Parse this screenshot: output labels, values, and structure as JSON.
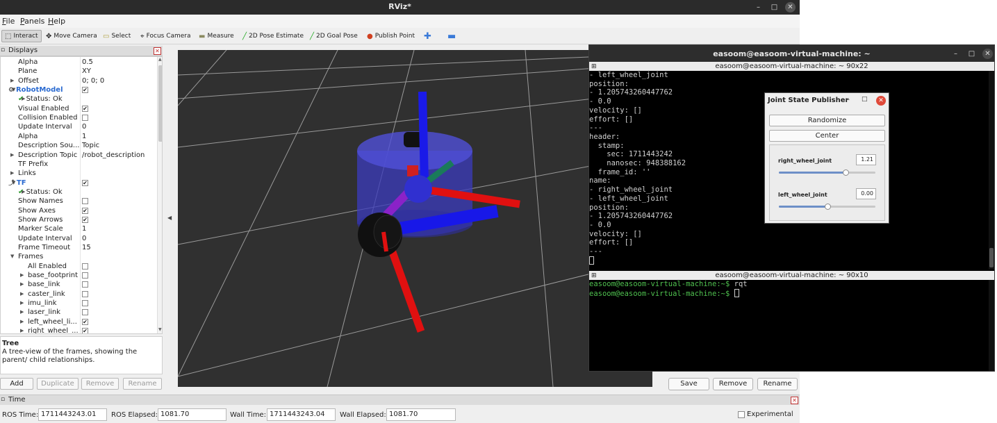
{
  "rviz": {
    "title": "RViz*",
    "menu": [
      "File",
      "Panels",
      "Help"
    ],
    "tools": [
      {
        "label": "Interact",
        "icon": "cursor-icon",
        "glyph": "⬚"
      },
      {
        "label": "Move Camera",
        "icon": "move-camera-icon",
        "glyph": "✥"
      },
      {
        "label": "Select",
        "icon": "select-icon",
        "glyph": "▭"
      },
      {
        "label": "Focus Camera",
        "icon": "focus-camera-icon",
        "glyph": "⌖"
      },
      {
        "label": "Measure",
        "icon": "measure-icon",
        "glyph": "▬"
      },
      {
        "label": "2D Pose Estimate",
        "icon": "pose-estimate-icon",
        "glyph": "╱"
      },
      {
        "label": "2D Goal Pose",
        "icon": "goal-pose-icon",
        "glyph": "╱"
      },
      {
        "label": "Publish Point",
        "icon": "publish-point-icon",
        "glyph": "●"
      }
    ],
    "displays_title": "Displays",
    "tree": [
      {
        "label": "Alpha",
        "value": "0.5",
        "indent": 25
      },
      {
        "label": "Plane",
        "value": "XY",
        "indent": 25
      },
      {
        "label": "Offset",
        "value": "0; 0; 0",
        "indent": 25,
        "arrow": true
      },
      {
        "label": "RobotModel",
        "checked": true,
        "indent": 27,
        "arrow": "down",
        "kind": "display"
      },
      {
        "label": "Status: Ok",
        "indent": 41,
        "arrow": true,
        "status": true
      },
      {
        "label": "Visual Enabled",
        "checked": true,
        "indent": 25
      },
      {
        "label": "Collision Enabled",
        "checked": false,
        "indent": 25
      },
      {
        "label": "Update Interval",
        "value": "0",
        "indent": 25
      },
      {
        "label": "Alpha",
        "value": "1",
        "indent": 25
      },
      {
        "label": "Description Sou...",
        "value": "Topic",
        "indent": 25
      },
      {
        "label": "Description Topic",
        "value": "/robot_description",
        "indent": 25,
        "arrow": true
      },
      {
        "label": "TF Prefix",
        "value": "",
        "indent": 25
      },
      {
        "label": "Links",
        "value": "",
        "indent": 25,
        "arrow": true
      },
      {
        "label": "TF",
        "checked": true,
        "indent": 27,
        "arrow": "down",
        "kind": "display"
      },
      {
        "label": "Status: Ok",
        "indent": 41,
        "arrow": true,
        "status": true
      },
      {
        "label": "Show Names",
        "checked": false,
        "indent": 25
      },
      {
        "label": "Show Axes",
        "checked": true,
        "indent": 25
      },
      {
        "label": "Show Arrows",
        "checked": true,
        "indent": 25
      },
      {
        "label": "Marker Scale",
        "value": "1",
        "indent": 25
      },
      {
        "label": "Update Interval",
        "value": "0",
        "indent": 25
      },
      {
        "label": "Frame Timeout",
        "value": "15",
        "indent": 25
      },
      {
        "label": "Frames",
        "value": "",
        "indent": 25,
        "arrow": "down"
      },
      {
        "label": "All Enabled",
        "checked": false,
        "indent": 39
      },
      {
        "label": "base_footprint",
        "checked": false,
        "indent": 39,
        "arrow": true
      },
      {
        "label": "base_link",
        "checked": false,
        "indent": 39,
        "arrow": true
      },
      {
        "label": "caster_link",
        "checked": false,
        "indent": 39,
        "arrow": true
      },
      {
        "label": "imu_link",
        "checked": false,
        "indent": 39,
        "arrow": true
      },
      {
        "label": "laser_link",
        "checked": false,
        "indent": 39,
        "arrow": true
      },
      {
        "label": "left_wheel_li...",
        "checked": true,
        "indent": 39,
        "arrow": true
      },
      {
        "label": "right_wheel_...",
        "checked": true,
        "indent": 39,
        "arrow": true
      }
    ],
    "description": {
      "title": "Tree",
      "text": "A tree-view of the frames, showing the parent/ child relationships."
    },
    "panel_buttons": [
      {
        "label": "Add",
        "enabled": true
      },
      {
        "label": "Duplicate",
        "enabled": false
      },
      {
        "label": "Remove",
        "enabled": false
      },
      {
        "label": "Rename",
        "enabled": false
      }
    ],
    "view_buttons": [
      "Save",
      "Remove",
      "Rename"
    ],
    "time": {
      "title": "Time",
      "ros_time_label": "ROS Time:",
      "ros_time": "1711443243.01",
      "ros_elapsed_label": "ROS Elapsed:",
      "ros_elapsed": "1081.70",
      "wall_time_label": "Wall Time:",
      "wall_time": "1711443243.04",
      "wall_elapsed_label": "Wall Elapsed:",
      "wall_elapsed": "1081.70",
      "experimental_label": "Experimental"
    }
  },
  "terminal": {
    "title": "easoom@easoom-virtual-machine: ~",
    "pane1_title": "easoom@easoom-virtual-machine: ~ 90x22",
    "pane1_lines": [
      "- left_wheel_joint",
      "position:",
      "- 1.205743260447762",
      "- 0.0",
      "velocity: []",
      "effort: []",
      "---",
      "header:",
      "  stamp:",
      "    sec: 1711443242",
      "    nanosec: 948388162",
      "  frame_id: ''",
      "name:",
      "- right_wheel_joint",
      "- left_wheel_joint",
      "position:",
      "- 1.205743260447762",
      "- 0.0",
      "velocity: []",
      "effort: []",
      "---"
    ],
    "pane2_title": "easoom@easoom-virtual-machine: ~ 90x10",
    "prompt": "easoom@easoom-virtual-machine:~$",
    "command": " rqt"
  },
  "jsp": {
    "title": "Joint State Publisher",
    "randomize": "Randomize",
    "center": "Center",
    "joints": [
      {
        "name": "right_wheel_joint",
        "value": "1.21",
        "level": 0.69
      },
      {
        "name": "left_wheel_joint",
        "value": "0.00",
        "level": 0.5
      }
    ]
  },
  "colors": {
    "axis_x": "#e00000",
    "axis_y": "#2020e0",
    "axis_z": "#0000ff",
    "robot_body": "#3a3acc",
    "grid": "#9a9a9a",
    "prompt": "#4fc14f"
  }
}
